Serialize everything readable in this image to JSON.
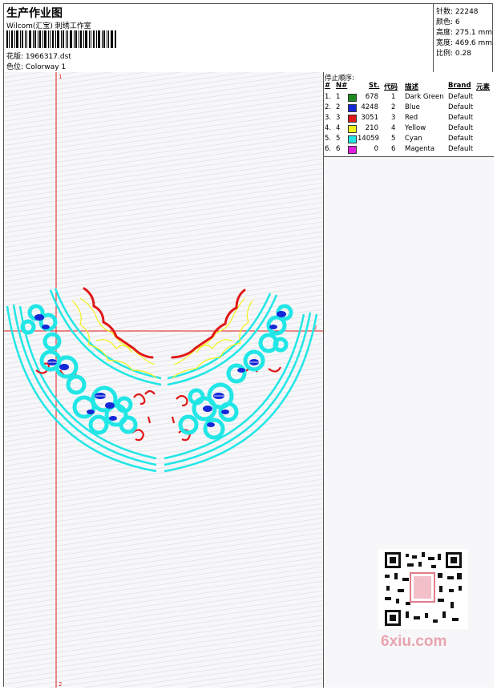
{
  "header": {
    "title": "生产作业图",
    "subtitle": "Wilcom(汇宝) 刺绣工作室",
    "design_label": "花版:",
    "design_value": "1966317.dst",
    "colorway_label": "色位:",
    "colorway_value": "Colorway 1"
  },
  "stats": {
    "stitches": "针数: 22248",
    "colors": "颜色: 6",
    "height": "高度: 275.1 mm",
    "width": "宽度: 469.6 mm",
    "scale": "比例: 0.28"
  },
  "legend": {
    "title": "停止顺序:",
    "headers": [
      "#",
      "N#",
      "St.",
      "代码",
      "描述",
      "Brand",
      "元素"
    ],
    "rows": [
      {
        "idx": "1.",
        "n": "1",
        "color": "#1e8a1e",
        "st": "678",
        "code": "1",
        "desc": "Dark Green",
        "brand": "Default"
      },
      {
        "idx": "2.",
        "n": "2",
        "color": "#1428d8",
        "st": "4248",
        "code": "2",
        "desc": "Blue",
        "brand": "Default"
      },
      {
        "idx": "3.",
        "n": "3",
        "color": "#e01818",
        "st": "3051",
        "code": "3",
        "desc": "Red",
        "brand": "Default"
      },
      {
        "idx": "4.",
        "n": "4",
        "color": "#f2f21a",
        "st": "210",
        "code": "4",
        "desc": "Yellow",
        "brand": "Default"
      },
      {
        "idx": "5.",
        "n": "5",
        "color": "#22e6e6",
        "st": "14059",
        "code": "5",
        "desc": "Cyan",
        "brand": "Default"
      },
      {
        "idx": "6.",
        "n": "6",
        "color": "#e01ee0",
        "st": "0",
        "code": "6",
        "desc": "Magenta",
        "brand": "Default"
      }
    ]
  },
  "axes": {
    "top_marker": "1",
    "right_marker": "2",
    "bottom_marker": "2"
  },
  "watermark": {
    "logo_text": "6xiu.com"
  }
}
